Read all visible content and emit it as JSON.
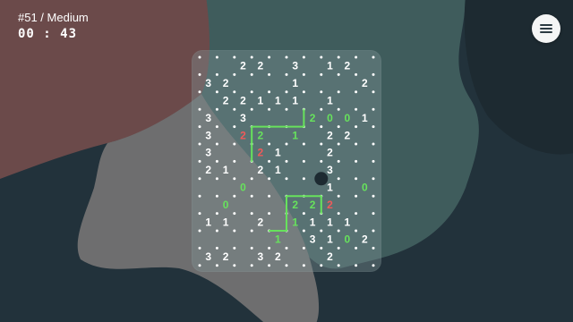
{
  "header": {
    "puzzle_label": "#51 / Medium",
    "timer": "00 : 43"
  },
  "menu": {
    "icon": "hamburger-menu-icon"
  },
  "colors": {
    "background": "#22323b",
    "rose_blob": "#6b4a4a",
    "teal_blob": "#3f5c5c",
    "grey_blob": "#6e6e6f",
    "number_default": "#ffffff",
    "number_satisfied": "#67e25c",
    "number_error": "#f05a5a",
    "loop_line": "#67e25c"
  },
  "board": {
    "columns": 10,
    "rows": 12,
    "clues": [
      {
        "row": 0,
        "col": 2,
        "value": "2",
        "state": "default"
      },
      {
        "row": 0,
        "col": 3,
        "value": "2",
        "state": "default"
      },
      {
        "row": 0,
        "col": 5,
        "value": "3",
        "state": "default"
      },
      {
        "row": 0,
        "col": 7,
        "value": "1",
        "state": "default"
      },
      {
        "row": 0,
        "col": 8,
        "value": "2",
        "state": "default"
      },
      {
        "row": 1,
        "col": 0,
        "value": "3",
        "state": "default"
      },
      {
        "row": 1,
        "col": 1,
        "value": "2",
        "state": "default"
      },
      {
        "row": 1,
        "col": 5,
        "value": "1",
        "state": "default"
      },
      {
        "row": 1,
        "col": 9,
        "value": "2",
        "state": "default"
      },
      {
        "row": 2,
        "col": 1,
        "value": "2",
        "state": "default"
      },
      {
        "row": 2,
        "col": 2,
        "value": "2",
        "state": "default"
      },
      {
        "row": 2,
        "col": 3,
        "value": "1",
        "state": "default"
      },
      {
        "row": 2,
        "col": 4,
        "value": "1",
        "state": "default"
      },
      {
        "row": 2,
        "col": 5,
        "value": "1",
        "state": "default"
      },
      {
        "row": 2,
        "col": 7,
        "value": "1",
        "state": "default"
      },
      {
        "row": 3,
        "col": 0,
        "value": "3",
        "state": "default"
      },
      {
        "row": 3,
        "col": 2,
        "value": "3",
        "state": "default"
      },
      {
        "row": 3,
        "col": 6,
        "value": "2",
        "state": "satisfied"
      },
      {
        "row": 3,
        "col": 7,
        "value": "0",
        "state": "satisfied"
      },
      {
        "row": 3,
        "col": 8,
        "value": "0",
        "state": "satisfied"
      },
      {
        "row": 3,
        "col": 9,
        "value": "1",
        "state": "default"
      },
      {
        "row": 4,
        "col": 0,
        "value": "3",
        "state": "default"
      },
      {
        "row": 4,
        "col": 2,
        "value": "2",
        "state": "error"
      },
      {
        "row": 4,
        "col": 3,
        "value": "2",
        "state": "satisfied"
      },
      {
        "row": 4,
        "col": 5,
        "value": "1",
        "state": "satisfied"
      },
      {
        "row": 4,
        "col": 7,
        "value": "2",
        "state": "default"
      },
      {
        "row": 4,
        "col": 8,
        "value": "2",
        "state": "default"
      },
      {
        "row": 5,
        "col": 0,
        "value": "3",
        "state": "default"
      },
      {
        "row": 5,
        "col": 3,
        "value": "2",
        "state": "error"
      },
      {
        "row": 5,
        "col": 4,
        "value": "1",
        "state": "default"
      },
      {
        "row": 5,
        "col": 7,
        "value": "2",
        "state": "default"
      },
      {
        "row": 6,
        "col": 0,
        "value": "2",
        "state": "default"
      },
      {
        "row": 6,
        "col": 1,
        "value": "1",
        "state": "default"
      },
      {
        "row": 6,
        "col": 3,
        "value": "2",
        "state": "default"
      },
      {
        "row": 6,
        "col": 4,
        "value": "1",
        "state": "default"
      },
      {
        "row": 6,
        "col": 7,
        "value": "3",
        "state": "default"
      },
      {
        "row": 7,
        "col": 2,
        "value": "0",
        "state": "satisfied"
      },
      {
        "row": 7,
        "col": 7,
        "value": "1",
        "state": "default"
      },
      {
        "row": 7,
        "col": 9,
        "value": "0",
        "state": "satisfied"
      },
      {
        "row": 8,
        "col": 1,
        "value": "0",
        "state": "satisfied"
      },
      {
        "row": 8,
        "col": 5,
        "value": "2",
        "state": "satisfied"
      },
      {
        "row": 8,
        "col": 6,
        "value": "2",
        "state": "satisfied"
      },
      {
        "row": 8,
        "col": 7,
        "value": "2",
        "state": "error"
      },
      {
        "row": 9,
        "col": 0,
        "value": "1",
        "state": "default"
      },
      {
        "row": 9,
        "col": 1,
        "value": "1",
        "state": "default"
      },
      {
        "row": 9,
        "col": 3,
        "value": "2",
        "state": "default"
      },
      {
        "row": 9,
        "col": 5,
        "value": "1",
        "state": "satisfied"
      },
      {
        "row": 9,
        "col": 6,
        "value": "1",
        "state": "default"
      },
      {
        "row": 9,
        "col": 7,
        "value": "1",
        "state": "default"
      },
      {
        "row": 9,
        "col": 8,
        "value": "1",
        "state": "default"
      },
      {
        "row": 10,
        "col": 4,
        "value": "1",
        "state": "satisfied"
      },
      {
        "row": 10,
        "col": 6,
        "value": "3",
        "state": "default"
      },
      {
        "row": 10,
        "col": 7,
        "value": "1",
        "state": "default"
      },
      {
        "row": 10,
        "col": 8,
        "value": "0",
        "state": "satisfied"
      },
      {
        "row": 10,
        "col": 9,
        "value": "2",
        "state": "default"
      },
      {
        "row": 11,
        "col": 0,
        "value": "3",
        "state": "default"
      },
      {
        "row": 11,
        "col": 1,
        "value": "2",
        "state": "default"
      },
      {
        "row": 11,
        "col": 3,
        "value": "3",
        "state": "default"
      },
      {
        "row": 11,
        "col": 4,
        "value": "2",
        "state": "default"
      },
      {
        "row": 11,
        "col": 7,
        "value": "2",
        "state": "default"
      }
    ],
    "loop_segments": [
      [
        [
          3,
          4
        ],
        [
          6,
          4
        ]
      ],
      [
        [
          6,
          4
        ],
        [
          6,
          3
        ]
      ],
      [
        [
          3,
          4
        ],
        [
          3,
          6
        ]
      ],
      [
        [
          5,
          8
        ],
        [
          7,
          8
        ]
      ],
      [
        [
          5,
          8
        ],
        [
          5,
          10
        ]
      ],
      [
        [
          5,
          10
        ],
        [
          4,
          10
        ]
      ],
      [
        [
          7,
          8
        ],
        [
          7,
          9
        ]
      ]
    ],
    "cursor_vertex": [
      7,
      7
    ]
  }
}
